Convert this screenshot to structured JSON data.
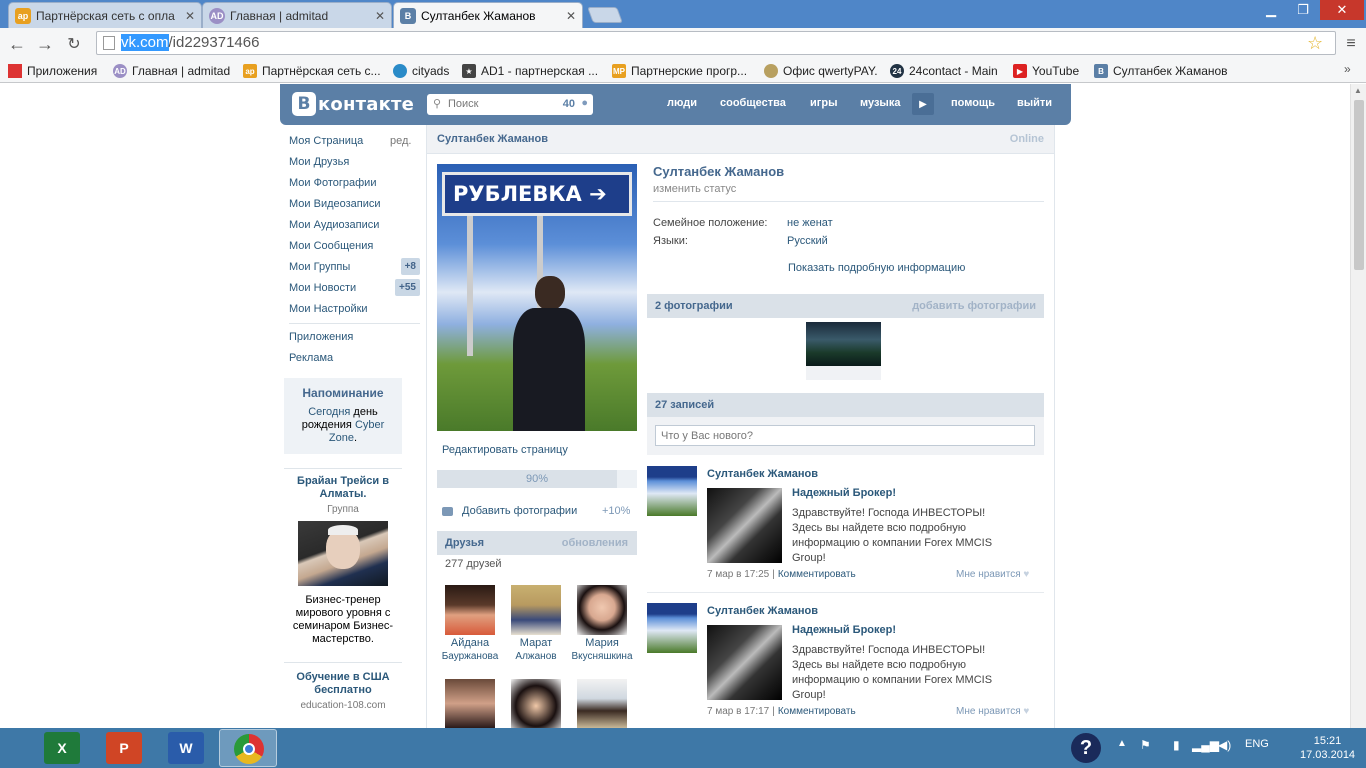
{
  "browser": {
    "tabs": [
      {
        "label": "Партнёрская сеть с опла",
        "favicon": "ap"
      },
      {
        "label": "Главная | admitad",
        "favicon": "AD"
      },
      {
        "label": "Султанбек Жаманов",
        "favicon": "B"
      }
    ],
    "url": {
      "host": "vk.com",
      "path": "/id229371466"
    },
    "bookmarks": [
      {
        "label": "Приложения",
        "icon": "apps-grid-icon"
      },
      {
        "label": "Главная | admitad",
        "icon": "admitad-icon"
      },
      {
        "label": "Партнёрская сеть с...",
        "icon": "ap-icon"
      },
      {
        "label": "cityads",
        "icon": "cityads-icon"
      },
      {
        "label": "AD1 - партнерская ...",
        "icon": "star-icon"
      },
      {
        "label": "Партнерские прогр...",
        "icon": "mp-icon"
      },
      {
        "label": "Офис qwertyPAY.",
        "icon": "qwertypay-icon"
      },
      {
        "label": "24contact - Main",
        "icon": "24-icon"
      },
      {
        "label": "YouTube",
        "icon": "youtube-icon"
      },
      {
        "label": "Султанбек Жаманов",
        "icon": "vk-icon"
      }
    ]
  },
  "vk": {
    "logo": {
      "letter": "В",
      "word": "контакте"
    },
    "search": {
      "placeholder": "Поиск",
      "count": "40"
    },
    "nav": [
      "люди",
      "сообщества",
      "игры",
      "музыка",
      "помощь",
      "выйти"
    ],
    "menu": [
      {
        "label": "Моя Страница",
        "extra": "ред."
      },
      {
        "label": "Мои Друзья"
      },
      {
        "label": "Мои Фотографии"
      },
      {
        "label": "Мои Видеозаписи"
      },
      {
        "label": "Мои Аудиозаписи"
      },
      {
        "label": "Мои Сообщения"
      },
      {
        "label": "Мои Группы",
        "badge": "+8"
      },
      {
        "label": "Мои Новости",
        "badge": "+55"
      },
      {
        "label": "Мои Настройки"
      }
    ],
    "menu2": [
      "Приложения",
      "Реклама"
    ],
    "reminder": {
      "title": "Напоминание",
      "l1": "Сегодня",
      "l1b": " день",
      "l2": "рождения ",
      "l2b": "Cyber",
      "l3": "Zone",
      "l3b": "."
    },
    "ad1": {
      "title": "Брайан Трейси в Алматы.",
      "sub": "Группа",
      "text": "Бизнес-тренер мирового уровня с семинаром Бизнес-мастерство."
    },
    "ad2": {
      "title": "Обучение в США бесплатно",
      "sub": "education-108.com"
    },
    "profile": {
      "name_bar": "Султанбек Жаманов",
      "online": "Online",
      "name": "Султанбек Жаманов",
      "status": "изменить статус",
      "info": [
        {
          "k": "Семейное положение:",
          "v": "не женат"
        },
        {
          "k": "Языки:",
          "v": "Русский"
        }
      ],
      "more": "Показать подробную информацию",
      "sign_text": "РУБЛЕВКА",
      "edit": "Редактировать страницу",
      "progress_label": "90%",
      "progress": 0.9,
      "add_photo": "Добавить фотографии",
      "add_photo_pct": "+10%",
      "friends_title": "Друзья",
      "friends_updates": "обновления",
      "friends_count": "277 друзей",
      "friends": [
        {
          "first": "Айдана",
          "last": "Бауржанова"
        },
        {
          "first": "Марат",
          "last": "Алжанов"
        },
        {
          "first": "Мария",
          "last": "Вкусняшкина"
        }
      ]
    },
    "photos": {
      "title": "2 фотографии",
      "action": "добавить фотографии"
    },
    "wall": {
      "title": "27 записей",
      "placeholder": "Что у Вас нового?",
      "posts": [
        {
          "author": "Султанбек Жаманов",
          "headline": "Надежный Брокер!",
          "text": "Здравствуйте! Господа ИНВЕСТОРЫ! Здесь вы найдете всю подробную информацию о компании Forex MMCIS Group!",
          "date": "7 мар в 17:25",
          "comment": "Комментировать",
          "like": "Мне нравится"
        },
        {
          "author": "Султанбек Жаманов",
          "headline": "Надежный Брокер!",
          "text": "Здравствуйте! Господа ИНВЕСТОРЫ! Здесь вы найдете всю подробную информацию о компании Forex MMCIS Group!",
          "date": "7 мар в 17:17",
          "comment": "Комментировать",
          "like": "Мне нравится"
        }
      ]
    }
  },
  "taskbar": {
    "lang": "ENG",
    "time": "15:21",
    "date": "17.03.2014"
  }
}
